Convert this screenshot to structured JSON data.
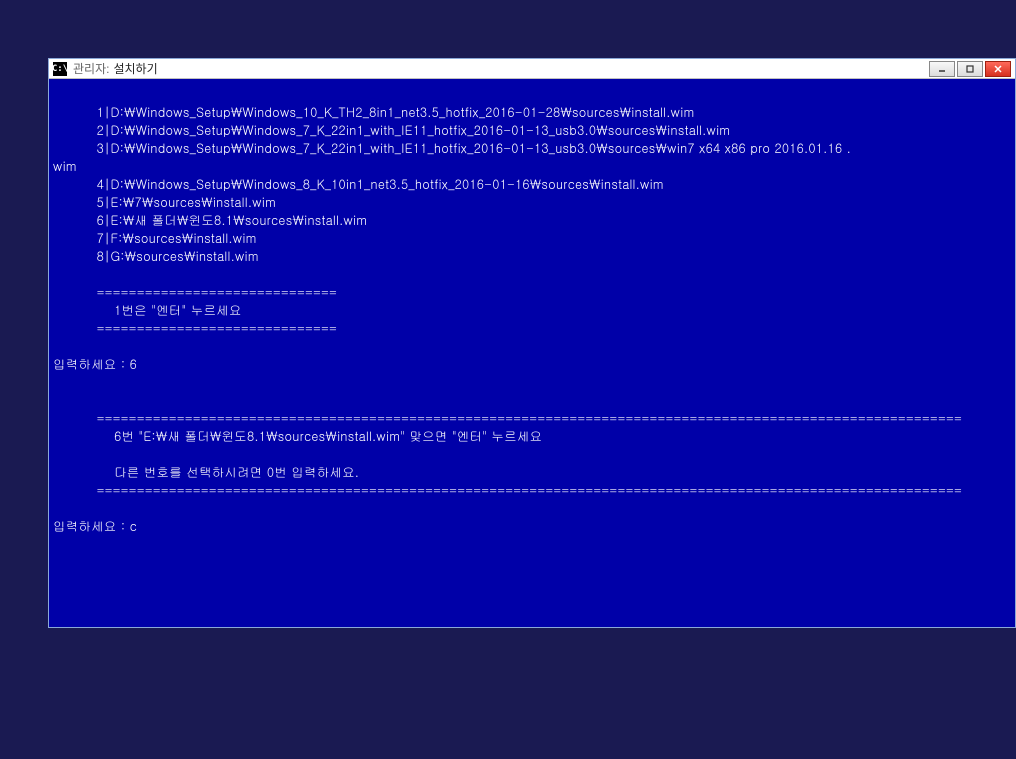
{
  "window": {
    "icon_text": "C:\\",
    "title_prefix": "관리자:",
    "title_main": "설치하기"
  },
  "console": {
    "lines": [
      "",
      "          1|D:\\Windows_Setup\\Windows_10_K_TH2_8in1_net3.5_hotfix_2016-01-28\\sources\\install.wim",
      "          2|D:\\Windows_Setup\\Windows_7_K_22in1_with_IE11_hotfix_2016-01-13_usb3.0\\sources\\install.wim",
      "          3|D:\\Windows_Setup\\Windows_7_K_22in1_with_IE11_hotfix_2016-01-13_usb3.0\\sources\\win7 x64 x86 pro 2016.01.16 .",
      "wim",
      "          4|D:\\Windows_Setup\\Windows_8_K_10in1_net3.5_hotfix_2016-01-16\\sources\\install.wim",
      "          5|E:\\7\\sources\\install.wim",
      "          6|E:\\새 폴더\\윈도8.1\\sources\\install.wim",
      "          7|F:\\sources\\install.wim",
      "          8|G:\\sources\\install.wim",
      "",
      "          ==============================",
      "              1번은 \"엔터\" 누르세요",
      "          ==============================",
      "",
      "입력하세요 : 6",
      "",
      "",
      "          ============================================================================================================",
      "              6번 \"E:\\새 폴더\\윈도8.1\\sources\\install.wim\" 맞으면 \"엔터\" 누르세요",
      "",
      "              다른 번호를 선택하시려면 0번 입력하세요.",
      "          ============================================================================================================",
      "",
      "입력하세요 : c"
    ]
  }
}
